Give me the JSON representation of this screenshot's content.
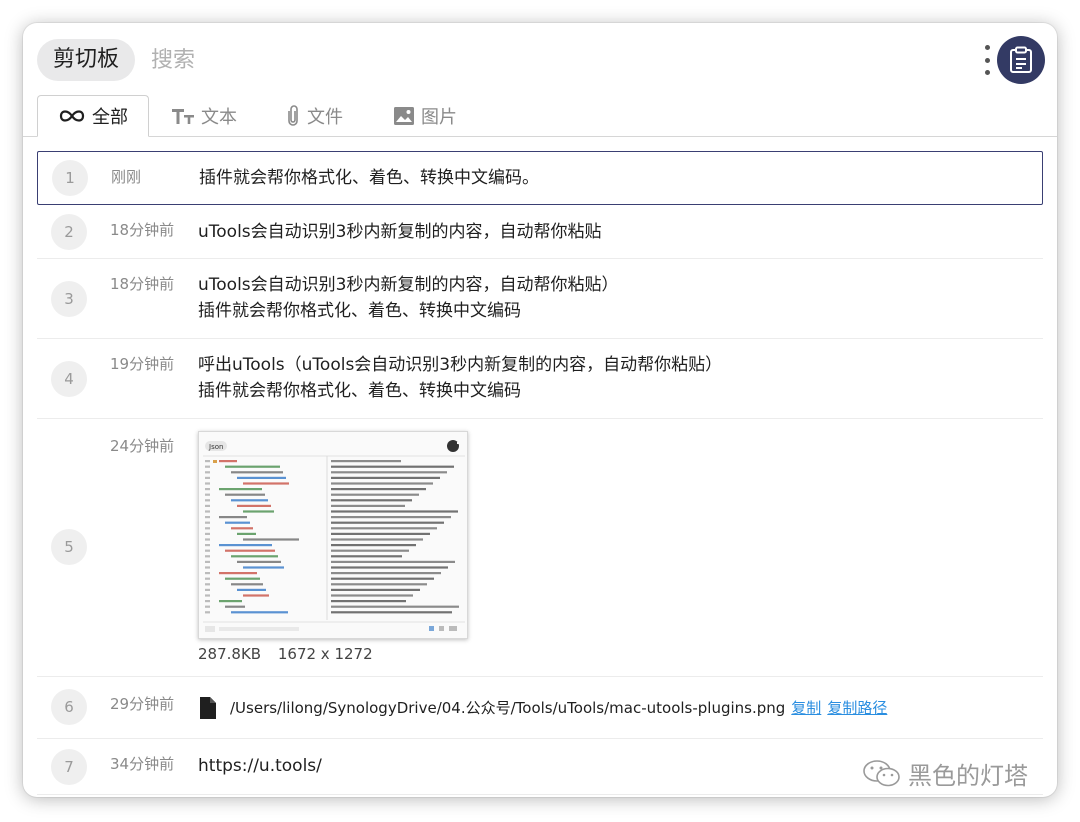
{
  "header": {
    "title": "剪切板",
    "search_placeholder": "搜索"
  },
  "tabs": [
    {
      "label": "全部",
      "icon": "infinity-icon",
      "active": true
    },
    {
      "label": "文本",
      "icon": "text-format-icon",
      "active": false
    },
    {
      "label": "文件",
      "icon": "paperclip-icon",
      "active": false
    },
    {
      "label": "图片",
      "icon": "image-icon",
      "active": false
    }
  ],
  "items": [
    {
      "index": "1",
      "time": "刚刚",
      "lines": [
        "插件就会帮你格式化、着色、转换中文编码。"
      ]
    },
    {
      "index": "2",
      "time": "18分钟前",
      "lines": [
        "uTools会自动识别3秒内新复制的内容，自动帮你粘贴"
      ]
    },
    {
      "index": "3",
      "time": "18分钟前",
      "lines": [
        "uTools会自动识别3秒内新复制的内容，自动帮你粘贴）",
        "插件就会帮你格式化、着色、转换中文编码"
      ]
    },
    {
      "index": "4",
      "time": "19分钟前",
      "lines": [
        "呼出uTools（uTools会自动识别3秒内新复制的内容，自动帮你粘贴）",
        "插件就会帮你格式化、着色、转换中文编码"
      ]
    },
    {
      "index": "5",
      "time": "24分钟前",
      "image_size": "287.8KB",
      "image_dims": "1672 x 1272",
      "thumb_tag": "Json"
    },
    {
      "index": "6",
      "time": "29分钟前",
      "file_path": "/Users/lilong/SynologyDrive/04.公众号/Tools/uTools/mac-utools-plugins.png",
      "copy_label": "复制",
      "copy_path_label": "复制路径"
    },
    {
      "index": "7",
      "time": "34分钟前",
      "lines": [
        "https://u.tools/"
      ]
    }
  ],
  "watermark": "黑色的灯塔",
  "colors": {
    "accent": "#3a3f73",
    "link": "#2a8ee0",
    "avatar_bg": "#333a64"
  }
}
